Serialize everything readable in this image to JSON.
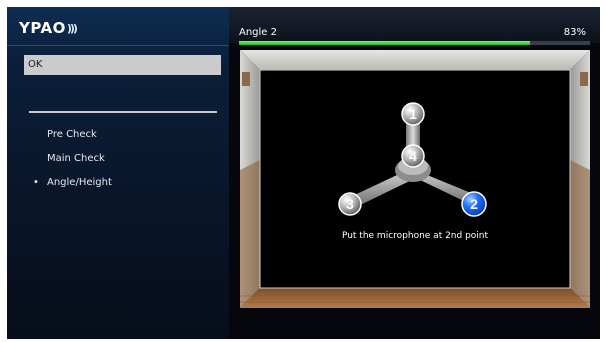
{
  "sidebar": {
    "logo_text": "YPAO",
    "status_value": "OK",
    "steps": [
      {
        "label": "Pre Check",
        "active": false
      },
      {
        "label": "Main Check",
        "active": false
      },
      {
        "label": "Angle/Height",
        "active": true
      }
    ],
    "bullet_char": "•"
  },
  "header": {
    "title": "Angle 2",
    "percent_text": "83%",
    "progress_fraction": 0.83
  },
  "main": {
    "instruction": "Put the microphone at 2nd point",
    "points": [
      {
        "number": "1",
        "active": false
      },
      {
        "number": "4",
        "active": false
      },
      {
        "number": "3",
        "active": false
      },
      {
        "number": "2",
        "active": true
      }
    ]
  },
  "colors": {
    "accent_blue": "#1e6fff",
    "progress_green": "#22b52b",
    "panel_blue": "#0f2d52"
  },
  "icons": {
    "logo_waves": "sound-wave-icon"
  }
}
